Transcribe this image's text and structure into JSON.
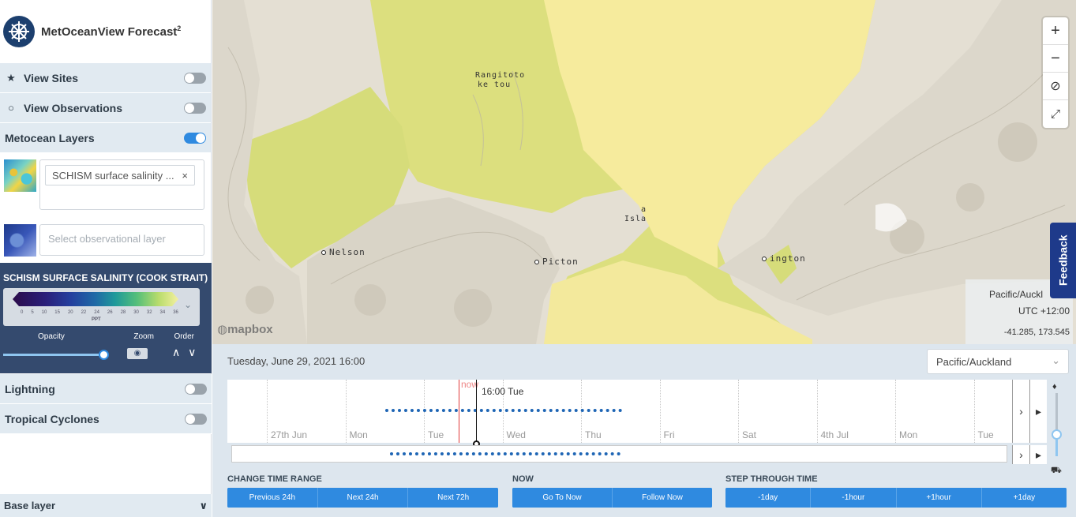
{
  "app": {
    "title": "MetOceanView Forecast",
    "title_sup": "2"
  },
  "sidebar": {
    "rows": [
      {
        "label": "View Sites",
        "icon": "star-icon",
        "on": false
      },
      {
        "label": "View Observations",
        "icon": "circle-icon",
        "on": false
      },
      {
        "label": "Metocean Layers",
        "icon": "",
        "on": true
      }
    ],
    "layer_tag": "SCHISM surface salinity ...",
    "obs_placeholder": "Select observational layer",
    "legend": {
      "title": "SCHISM SURFACE SALINITY (COOK STRAIT)",
      "ticks": [
        "0",
        "5",
        "10",
        "15",
        "20",
        "22",
        "24",
        "26",
        "28",
        "30",
        "32",
        "34",
        "36"
      ],
      "unit": "PPT",
      "opacity_label": "Opacity",
      "zoom_label": "Zoom",
      "order_label": "Order",
      "opacity_value": 1.0
    },
    "rows2": [
      {
        "label": "Lightning",
        "on": false
      },
      {
        "label": "Tropical Cyclones",
        "on": false
      }
    ],
    "base_layer": "Base layer"
  },
  "map": {
    "cities": [
      "Nelson",
      "Picton",
      "ington"
    ],
    "labels": [
      "Rangitoto",
      "ke tou",
      "a",
      "Isla"
    ],
    "attribution": "mapbox",
    "tz_name": "Pacific/Auckl",
    "tz_offset": "UTC +12:00",
    "coords": "-41.285, 173.545",
    "feedback": "Feedback"
  },
  "timeline": {
    "date_label": "Tuesday, June 29, 2021 16:00",
    "tz_select": "Pacific/Auckland",
    "days": [
      "27th Jun",
      "Mon",
      "Tue",
      "Wed",
      "Thu",
      "Fri",
      "Sat",
      "4th Jul",
      "Mon",
      "Tue"
    ],
    "now_label": "now",
    "current_label": "16:00 Tue"
  },
  "controls": {
    "time_range": {
      "title": "CHANGE TIME RANGE",
      "buttons": [
        "Previous 24h",
        "Next 24h",
        "Next 72h"
      ]
    },
    "now": {
      "title": "NOW",
      "buttons": [
        "Go To Now",
        "Follow Now"
      ]
    },
    "step": {
      "title": "STEP THROUGH TIME",
      "buttons": [
        "-1day",
        "-1hour",
        "+1hour",
        "+1day"
      ]
    }
  },
  "colors": {
    "accent": "#2f8ae0",
    "navy": "#344a6e",
    "sea": "#f7ec9e",
    "land": "#e6e1d6"
  }
}
